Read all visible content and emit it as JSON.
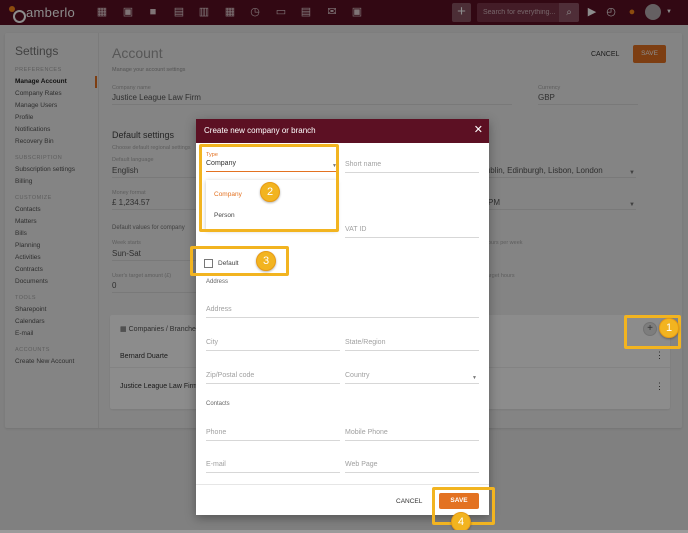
{
  "topbar": {
    "logo": "amberlo",
    "search_placeholder": "Search for everything...",
    "plus": "+",
    "nav_icons": [
      "dashboard-icon",
      "contacts-icon",
      "briefcase-icon",
      "document-icon",
      "bank-icon",
      "calendar-icon",
      "history-icon",
      "folder-icon",
      "notes-icon",
      "mail-icon",
      "template-icon"
    ],
    "right_icons": [
      "play-icon",
      "timer-icon",
      "notification-icon",
      "user-avatar"
    ]
  },
  "sidebar": {
    "title": "Settings",
    "sections": [
      {
        "label": "PREFERENCES",
        "items": [
          "Manage Account",
          "Company Rates",
          "Manage Users",
          "Profile",
          "Notifications",
          "Recovery Bin"
        ]
      },
      {
        "label": "SUBSCRIPTION",
        "items": [
          "Subscription settings",
          "Billing"
        ]
      },
      {
        "label": "CUSTOMIZE",
        "items": [
          "Contacts",
          "Matters",
          "Bills",
          "Planning",
          "Activities",
          "Contracts",
          "Documents"
        ]
      },
      {
        "label": "TOOLS",
        "items": [
          "Sharepoint",
          "Calendars",
          "E-mail"
        ]
      },
      {
        "label": "ACCOUNTS",
        "items": [
          "Create New Account"
        ]
      }
    ]
  },
  "main": {
    "title": "Account",
    "subtitle": "Manage your account settings",
    "cancel": "CANCEL",
    "save": "SAVE",
    "company_name_label": "Company name",
    "company_name": "Justice League Law Firm",
    "currency_label": "Currency",
    "currency": "GBP",
    "default_settings_title": "Default settings",
    "default_settings_sub": "Choose default regional settings",
    "language_label": "Default language",
    "language": "English",
    "timezone": "Dublin, Edinburgh, Lisbon, London",
    "money_label": "Money format",
    "money": "£ 1,234.57",
    "time_format": "PM",
    "company_values_label": "Default values for company",
    "week_label": "Week starts",
    "week": "Sun-Sat",
    "hours_per_week_label": "Hours per week",
    "target_label": "User's target amount (£)",
    "target": "0",
    "target_hours_label": "Target hours",
    "companies_header": "Companies / Branches",
    "companies": [
      "Bernard Duarte",
      "Justice League Law Firm"
    ]
  },
  "dialog": {
    "title": "Create new company or branch",
    "type_label": "Type",
    "type_value": "Company",
    "type_options": [
      "Company",
      "Person"
    ],
    "short_name": "Short name",
    "vat_id": "VAT ID",
    "default_label": "Default",
    "address_section": "Address",
    "address": "Address",
    "city": "City",
    "state": "State/Region",
    "zip": "Zip/Postal code",
    "country": "Country",
    "contacts_section": "Contacts",
    "phone": "Phone",
    "mobile": "Mobile Phone",
    "email": "E-mail",
    "web": "Web Page",
    "cancel": "CANCEL",
    "save": "SAVE"
  },
  "callouts": [
    "1",
    "2",
    "3",
    "4"
  ],
  "colors": {
    "brand": "#5c1023",
    "accent": "#e37222",
    "highlight": "#f2b420"
  }
}
